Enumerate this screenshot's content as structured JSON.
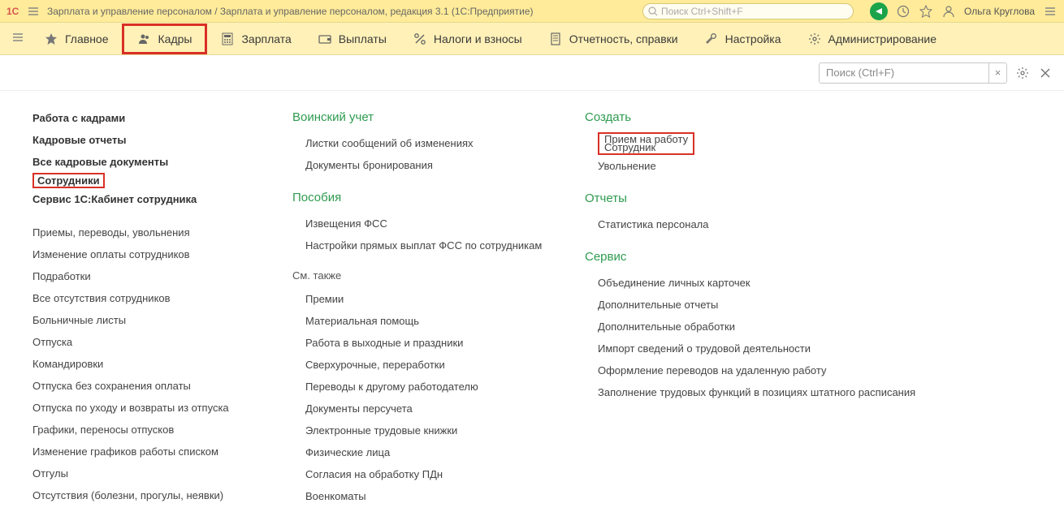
{
  "title": "Зарплата и управление персоналом / Зарплата и управление персоналом, редакция 3.1  (1С:Предприятие)",
  "global_search_placeholder": "Поиск Ctrl+Shift+F",
  "user_name": "Ольга Круглова",
  "nav": [
    {
      "label": "Главное"
    },
    {
      "label": "Кадры"
    },
    {
      "label": "Зарплата"
    },
    {
      "label": "Выплаты"
    },
    {
      "label": "Налоги и взносы"
    },
    {
      "label": "Отчетность, справки"
    },
    {
      "label": "Настройка"
    },
    {
      "label": "Администрирование"
    }
  ],
  "sub_search_placeholder": "Поиск (Ctrl+F)",
  "col1": {
    "bold_links": [
      "Работа с кадрами",
      "Кадровые отчеты",
      "Все кадровые документы",
      "Сотрудники",
      "Сервис 1С:Кабинет сотрудника"
    ],
    "plain_links": [
      "Приемы, переводы, увольнения",
      "Изменение оплаты сотрудников",
      "Подработки",
      "Все отсутствия сотрудников",
      "Больничные листы",
      "Отпуска",
      "Командировки",
      "Отпуска без сохранения оплаты",
      "Отпуска по уходу и возвраты из отпуска",
      "Графики, переносы отпусков",
      "Изменение графиков работы списком",
      "Отгулы",
      "Отсутствия (болезни, прогулы, неявки)"
    ]
  },
  "col2": {
    "sec1_head": "Воинский учет",
    "sec1_links": [
      "Листки сообщений об изменениях",
      "Документы бронирования"
    ],
    "sec2_head": "Пособия",
    "sec2_links": [
      "Извещения ФСС",
      "Настройки прямых выплат ФСС по сотрудникам"
    ],
    "see_also": "См. также",
    "see_also_links": [
      "Премии",
      "Материальная помощь",
      "Работа в выходные и праздники",
      "Сверхурочные, переработки",
      "Переводы к другому работодателю",
      "Документы персучета",
      "Электронные трудовые книжки",
      "Физические лица",
      "Согласия на обработку ПДн",
      "Военкоматы"
    ]
  },
  "col3": {
    "create_head": "Создать",
    "create_links": [
      "Прием на работу",
      "Сотрудник",
      "Увольнение"
    ],
    "reports_head": "Отчеты",
    "reports_links": [
      "Статистика персонала"
    ],
    "service_head": "Сервис",
    "service_links": [
      "Объединение личных карточек",
      "Дополнительные отчеты",
      "Дополнительные обработки",
      "Импорт сведений о трудовой деятельности",
      "Оформление переводов на удаленную работу",
      "Заполнение трудовых функций в позициях штатного расписания"
    ]
  }
}
